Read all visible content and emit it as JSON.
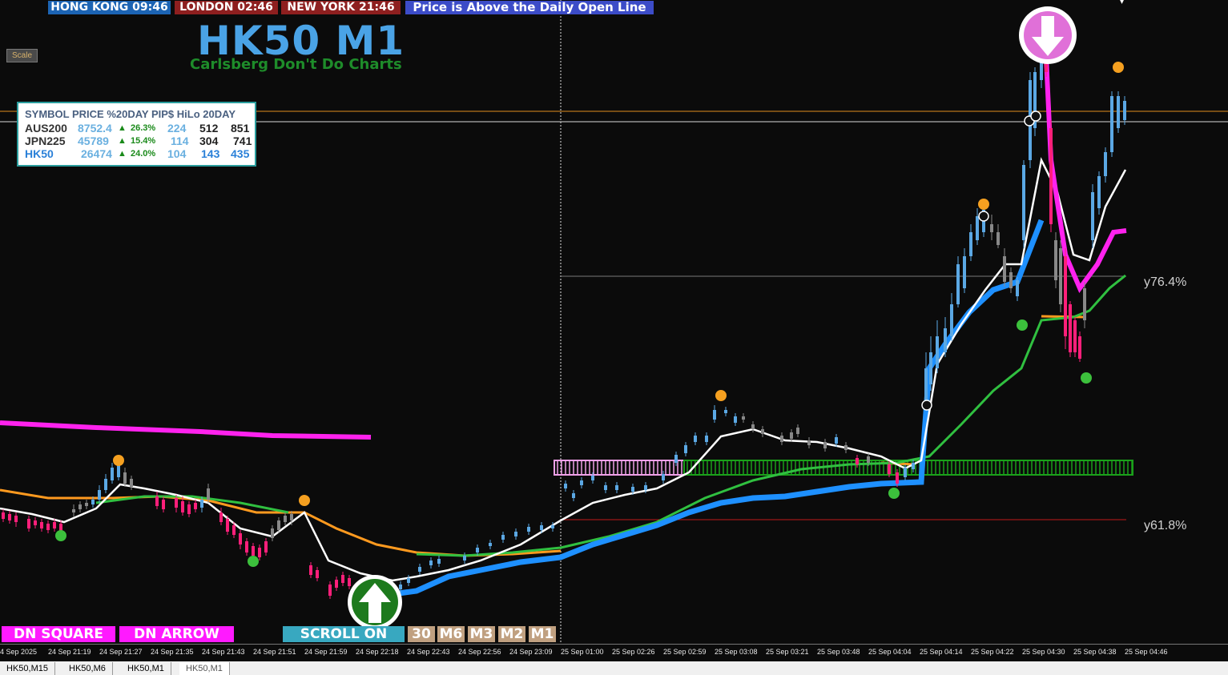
{
  "sessions": {
    "hong_kong": "HONG KONG  09:46",
    "london": "LONDON  02:46",
    "new_york": "NEW YORK  21:46",
    "price_msg": "Price is Above the Daily Open Line"
  },
  "chart_title": "HK50 M1",
  "chart_subtitle": "Carlsberg Don't Do Charts",
  "scale_button": "Scale",
  "symbol_table": {
    "header": "SYMBOL PRICE %20DAY PIP$ HiLo 20DAY",
    "rows": [
      {
        "symbol": "AUS200",
        "price": "8752.4",
        "arrow": "▲",
        "pct": "26.3%",
        "pips": "224",
        "hilo": "512",
        "day20": "851"
      },
      {
        "symbol": "JPN225",
        "price": "45789",
        "arrow": "▲",
        "pct": "15.4%",
        "pips": "114",
        "hilo": "304",
        "day20": "741"
      },
      {
        "symbol": "HK50",
        "price": "26474",
        "arrow": "▲",
        "pct": "24.0%",
        "pips": "104",
        "hilo": "143",
        "day20": "435"
      }
    ]
  },
  "fib_levels": {
    "upper": "y76.4%",
    "lower": "y61.8%"
  },
  "buttons": {
    "dn_square": "DN SQUARE",
    "dn_arrow": "DN ARROW",
    "scroll": "SCROLL ON",
    "tf_30": "30",
    "tf_m6": "M6",
    "tf_m3": "M3",
    "tf_m2": "M2",
    "tf_m1": "M1"
  },
  "time_labels": [
    "4 Sep 2025",
    "24 Sep 21:19",
    "24 Sep 21:27",
    "24 Sep 21:35",
    "24 Sep 21:43",
    "24 Sep 21:51",
    "24 Sep 21:59",
    "24 Sep 22:18",
    "24 Sep 22:43",
    "24 Sep 22:56",
    "24 Sep 23:09",
    "25 Sep 01:00",
    "25 Sep 02:26",
    "25 Sep 02:59",
    "25 Sep 03:08",
    "25 Sep 03:21",
    "25 Sep 03:48",
    "25 Sep 04:04",
    "25 Sep 04:14",
    "25 Sep 04:22",
    "25 Sep 04:30",
    "25 Sep 04:38",
    "25 Sep 04:46"
  ],
  "tabs": [
    "HK50,M15",
    "HK50,M6",
    "HK50,M1",
    "HK50,M1"
  ],
  "colors": {
    "hong_kong_bg": "#1c64b4",
    "london_bg": "#8e1f1f",
    "new_york_bg": "#8e1f1f",
    "price_msg_bg": "#3c4cc8",
    "up_candle": "#5ba8e4",
    "down_candle": "#ff1f7a",
    "magenta_line": "#ff22ee",
    "blue_line": "#1e90ff",
    "green_line": "#30c040",
    "orange_line": "#ff9a1f"
  }
}
